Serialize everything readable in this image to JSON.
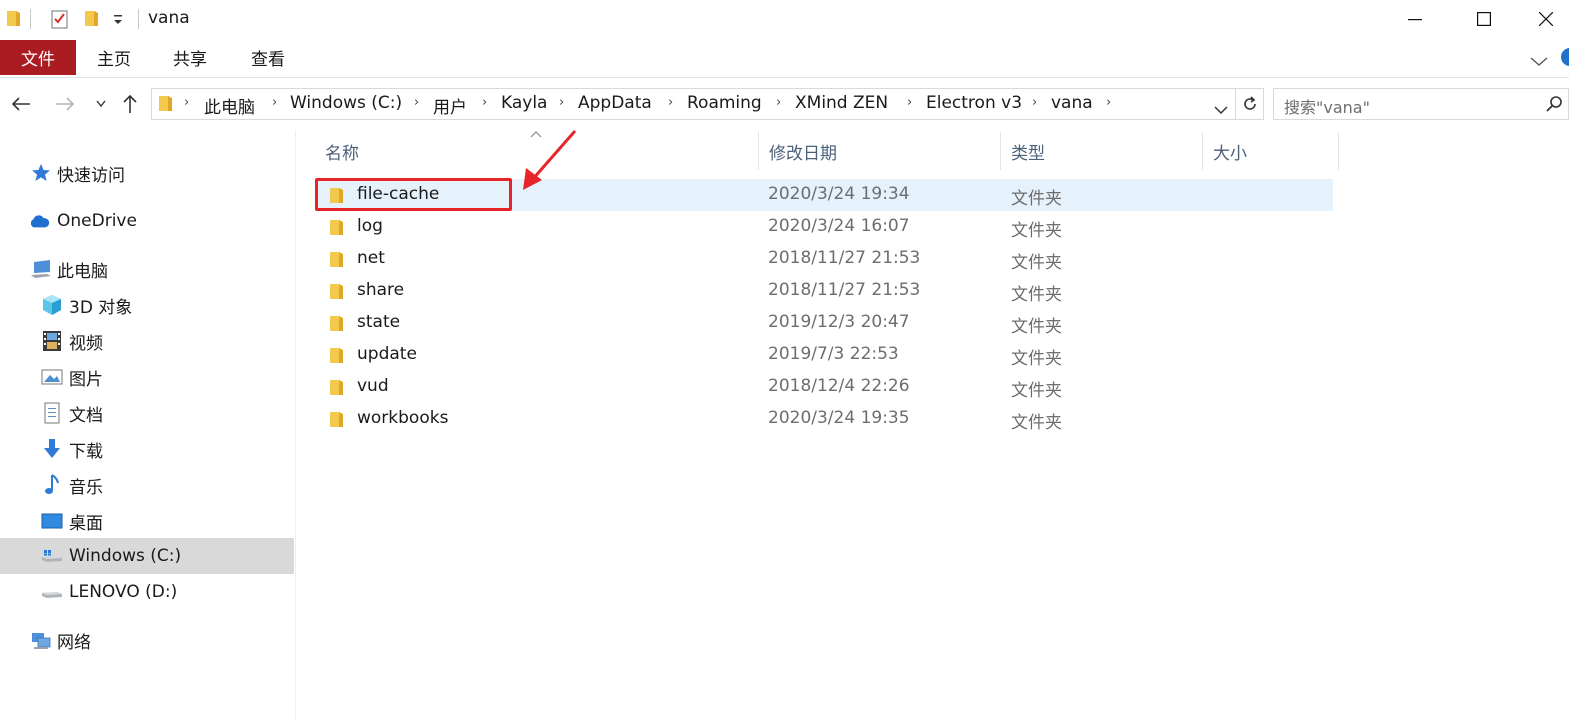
{
  "window": {
    "title": "vana"
  },
  "ribbon": {
    "tabs": [
      "文件",
      "主页",
      "共享",
      "查看"
    ]
  },
  "address": {
    "crumbs": [
      "此电脑",
      "Windows (C:)",
      "用户",
      "Kayla",
      "AppData",
      "Roaming",
      "XMind ZEN",
      "Electron v3",
      "vana"
    ]
  },
  "search": {
    "placeholder": "搜索\"vana\""
  },
  "sidebar": {
    "quick_access": "快速访问",
    "onedrive": "OneDrive",
    "this_pc": "此电脑",
    "items": [
      "3D 对象",
      "视频",
      "图片",
      "文档",
      "下载",
      "音乐",
      "桌面",
      "Windows (C:)",
      "LENOVO (D:)"
    ],
    "network": "网络"
  },
  "columns": {
    "name": "名称",
    "date": "修改日期",
    "type": "类型",
    "size": "大小"
  },
  "files": [
    {
      "name": "file-cache",
      "date": "2020/3/24 19:34",
      "type": "文件夹"
    },
    {
      "name": "log",
      "date": "2020/3/24 16:07",
      "type": "文件夹"
    },
    {
      "name": "net",
      "date": "2018/11/27 21:53",
      "type": "文件夹"
    },
    {
      "name": "share",
      "date": "2018/11/27 21:53",
      "type": "文件夹"
    },
    {
      "name": "state",
      "date": "2019/12/3 20:47",
      "type": "文件夹"
    },
    {
      "name": "update",
      "date": "2019/7/3 22:53",
      "type": "文件夹"
    },
    {
      "name": "vud",
      "date": "2018/12/4 22:26",
      "type": "文件夹"
    },
    {
      "name": "workbooks",
      "date": "2020/3/24 19:35",
      "type": "文件夹"
    }
  ],
  "colors": {
    "file_tab": "#ab1b22",
    "selection": "#e5f1fb",
    "annotation": "#e8242b",
    "folder": "#f2c94c"
  }
}
